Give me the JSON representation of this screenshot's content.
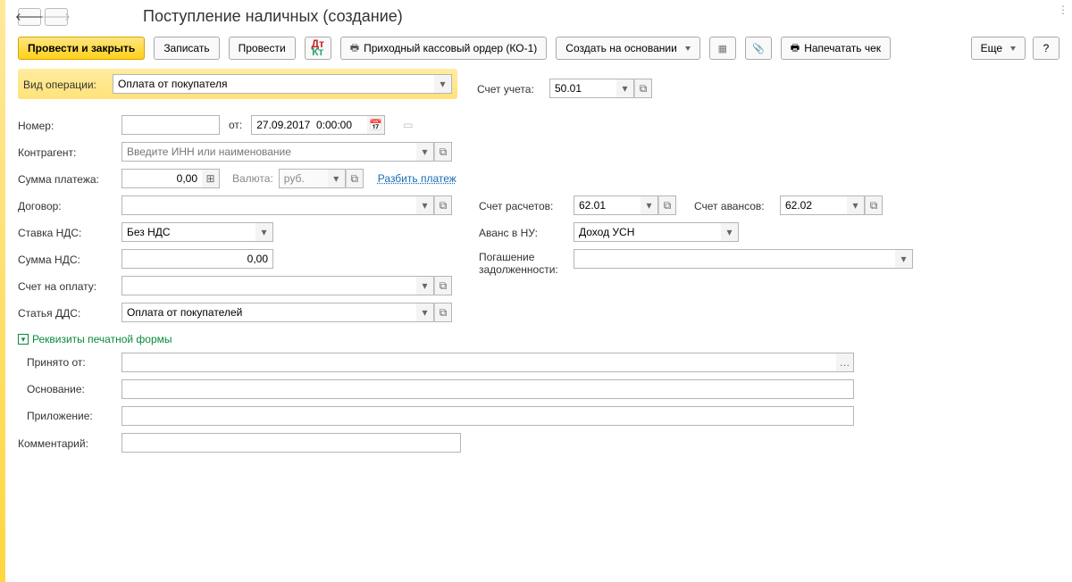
{
  "header": {
    "title": "Поступление наличных (создание)"
  },
  "toolbar": {
    "primary": "Провести и закрыть",
    "save": "Записать",
    "post": "Провести",
    "print_ko1": "Приходный кассовый ордер (КО-1)",
    "create_based": "Создать на основании",
    "print_receipt": "Напечатать чек",
    "more": "Еще"
  },
  "op": {
    "label": "Вид операции:",
    "value": "Оплата от покупателя"
  },
  "account": {
    "label": "Счет учета:",
    "value": "50.01"
  },
  "number": {
    "label": "Номер:",
    "from": "от:",
    "date": "27.09.2017  0:00:00"
  },
  "contragent": {
    "label": "Контрагент:",
    "placeholder": "Введите ИНН или наименование"
  },
  "amount": {
    "label": "Сумма платежа:",
    "value": "0,00",
    "currency_label": "Валюта:",
    "currency": "руб.",
    "split": "Разбить платеж"
  },
  "contract": {
    "label": "Договор:"
  },
  "calc_account": {
    "label": "Счет расчетов:",
    "value": "62.01"
  },
  "advance_account": {
    "label": "Счет авансов:",
    "value": "62.02"
  },
  "vat_rate": {
    "label": "Ставка НДС:",
    "value": "Без НДС"
  },
  "advance_nu": {
    "label": "Аванс в НУ:",
    "value": "Доход УСН"
  },
  "vat_sum": {
    "label": "Сумма НДС:",
    "value": "0,00"
  },
  "debt": {
    "label": "Погашение задолженности:"
  },
  "invoice": {
    "label": "Счет на оплату:"
  },
  "dds": {
    "label": "Статья ДДС:",
    "value": "Оплата от покупателей"
  },
  "printform": {
    "title": "Реквизиты печатной формы",
    "from": "Принято от:",
    "basis": "Основание:",
    "attach": "Приложение:"
  },
  "comment": {
    "label": "Комментарий:"
  }
}
